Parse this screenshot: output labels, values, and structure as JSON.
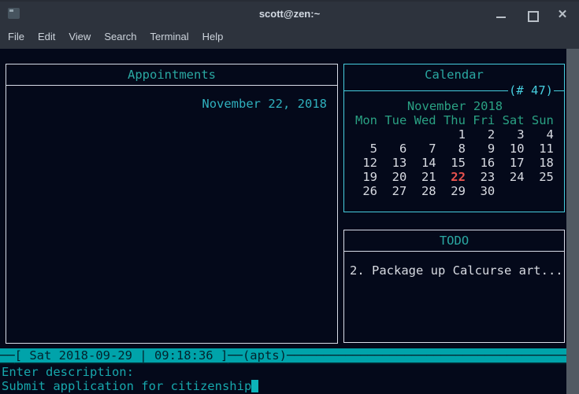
{
  "window": {
    "title": "scott@zen:~",
    "menu": [
      "File",
      "Edit",
      "View",
      "Search",
      "Terminal",
      "Help"
    ],
    "controls": [
      "minimize",
      "maximize",
      "close"
    ]
  },
  "panels": {
    "appointments": {
      "title": "Appointments",
      "date_line": "November 22, 2018"
    },
    "calendar": {
      "title": "Calendar",
      "badge": "(# 47)",
      "month_year": "November 2018",
      "weekdays": [
        "Mon",
        "Tue",
        "Wed",
        "Thu",
        "Fri",
        "Sat",
        "Sun"
      ],
      "cells": [
        "",
        "",
        "",
        "1",
        "2",
        "3",
        "4",
        "5",
        "6",
        "7",
        "8",
        "9",
        "10",
        "11",
        "12",
        "13",
        "14",
        "15",
        "16",
        "17",
        "18",
        "19",
        "20",
        "21",
        "22",
        "23",
        "24",
        "25",
        "26",
        "27",
        "28",
        "29",
        "30",
        "",
        ""
      ],
      "highlighted_day": "22"
    },
    "todo": {
      "title": "TODO",
      "items": [
        "2. Package up Calcurse art..."
      ]
    }
  },
  "notify_bar": {
    "lead": "──",
    "datetime": "[ Sat 2018-09-29 | 09:18:36 ]",
    "mid": "──",
    "panel_label": "(apts)",
    "trail": "────────────────────────────────────────────────────────"
  },
  "prompt": {
    "label": "Enter description:",
    "input_value": "Submit application for citizenship"
  },
  "colors": {
    "chrome_bg": "#2d333d",
    "chrome_text": "#d3dae3",
    "terminal_bg": "#04091a",
    "panel_border": "#d8dce8",
    "active_border": "#46cdde",
    "panel_title": "#2aa8a2",
    "accent_cyan": "#46cdde",
    "date_text": "#2fb0bd",
    "month_text": "#2aa183",
    "day_text": "#d8dbe2",
    "day_highlight": "#e8524e",
    "notify_bg": "#00a3aa",
    "notify_text": "#03222c",
    "input_text": "#17a7ac",
    "cursor": "#0db3ba",
    "scrollbar": "#525a63"
  }
}
